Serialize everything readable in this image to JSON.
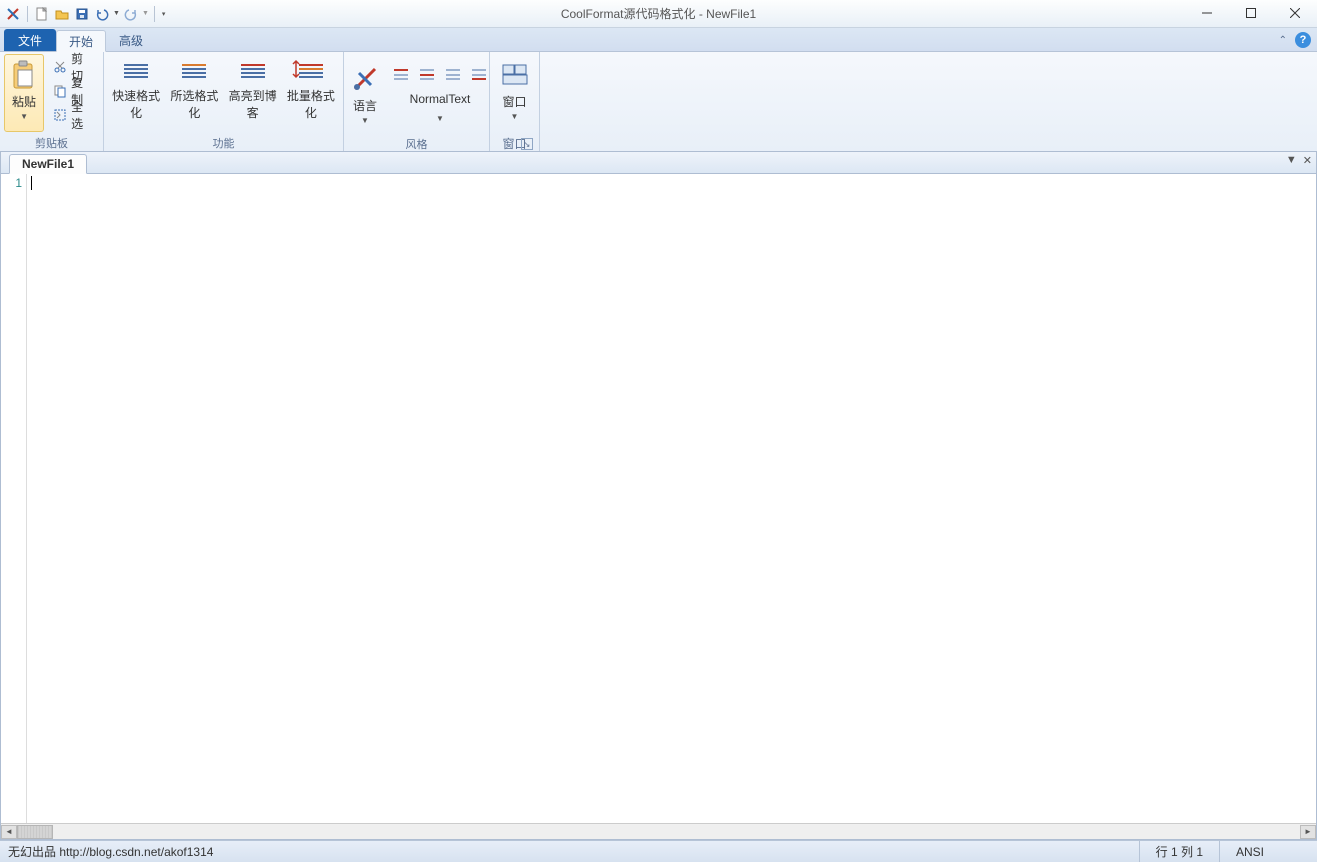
{
  "title": "CoolFormat源代码格式化 - NewFile1",
  "tabs": {
    "file": "文件",
    "start": "开始",
    "advanced": "高级"
  },
  "ribbon": {
    "clipboard": {
      "label": "剪贴板",
      "paste": "粘贴",
      "cut": "剪切",
      "copy": "复制",
      "selectAll": "全选"
    },
    "func": {
      "label": "功能",
      "fastFormat": "快速格式化",
      "selFormat": "所选格式化",
      "highlightBlog": "高亮到博客",
      "batchFormat": "批量格式化"
    },
    "style": {
      "label": "风格",
      "language": "语言",
      "normal": "NormalText"
    },
    "window": {
      "label": "窗口",
      "btn": "窗口"
    }
  },
  "doc": {
    "tab": "NewFile1",
    "line1": "1"
  },
  "status": {
    "left": "无幻出品 http://blog.csdn.net/akof1314",
    "rowcol": "行 1  列 1",
    "encoding": "ANSI"
  }
}
